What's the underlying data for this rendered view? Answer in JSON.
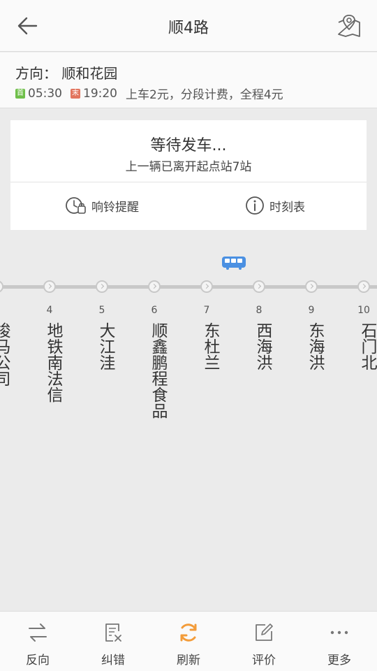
{
  "header": {
    "title": "顺4路",
    "back_icon": "arrow-left-icon",
    "map_icon": "map-pin-icon"
  },
  "route_info": {
    "direction": "方向：  顺和花园",
    "first_tag": "首",
    "first_time": "05:30",
    "last_tag": "末",
    "last_time": "19:20",
    "fare": "上车2元，分段计费，全程4元",
    "colors": {
      "first": "#6fbf4a",
      "last": "#e2755e"
    }
  },
  "status_card": {
    "status": "等待发车...",
    "subtitle": "上一辆已离开起点站7站",
    "remind_label": "响铃提醒",
    "timetable_label": "时刻表"
  },
  "stations": [
    {
      "num": "",
      "name": "梭马公司"
    },
    {
      "num": "4",
      "name": "地铁南法信"
    },
    {
      "num": "5",
      "name": "大江洼"
    },
    {
      "num": "6",
      "name": "顺鑫鹏程食品"
    },
    {
      "num": "7",
      "name": "东杜兰"
    },
    {
      "num": "8",
      "name": "西海洪"
    },
    {
      "num": "9",
      "name": "东海洪"
    },
    {
      "num": "10",
      "name": "石门北"
    }
  ],
  "bus_position_station": "7",
  "bus_color": "#4a90e2",
  "tabbar": {
    "reverse": "反向",
    "correct": "纠错",
    "refresh": "刷新",
    "review": "评价",
    "more": "更多"
  },
  "accent_color": "#f39c3a"
}
